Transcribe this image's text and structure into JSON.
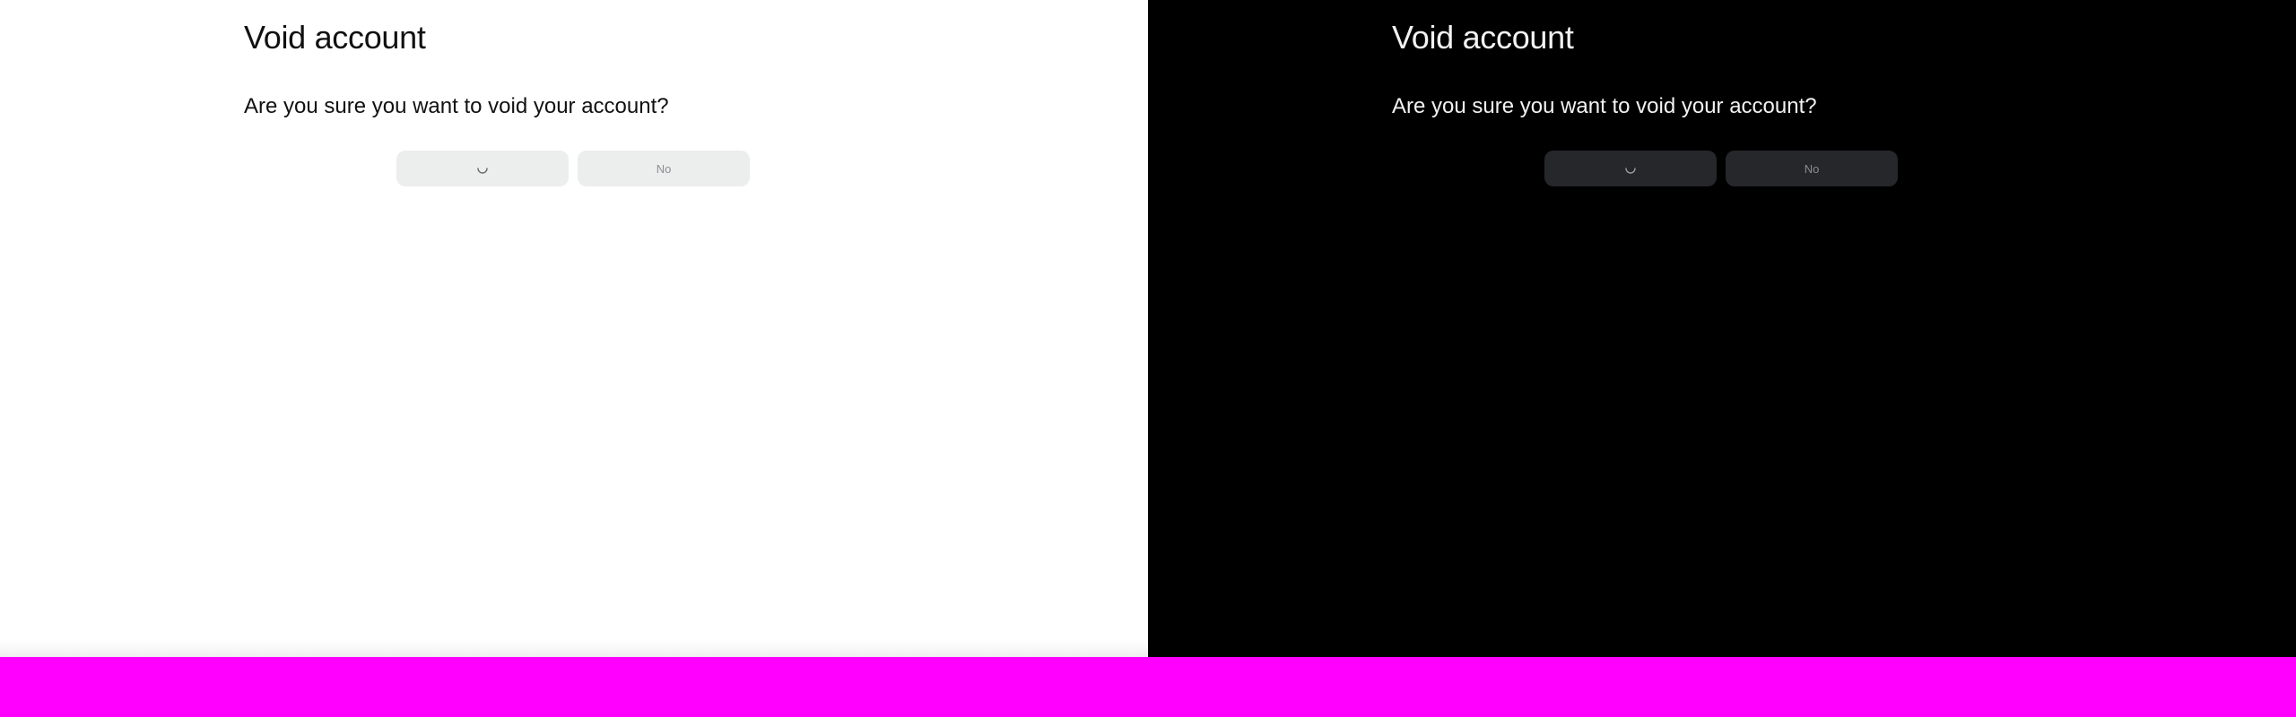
{
  "dialog": {
    "title": "Void account",
    "message": "Are you sure you want to void your account?",
    "yes_state_icon": "loading-spinner-icon",
    "no_label": "No"
  },
  "theme": {
    "light_background": "#ffffff",
    "dark_background": "#000000",
    "light_button": "#eceded",
    "dark_button": "#25272a",
    "bottom_bar": "#ff00ff"
  }
}
